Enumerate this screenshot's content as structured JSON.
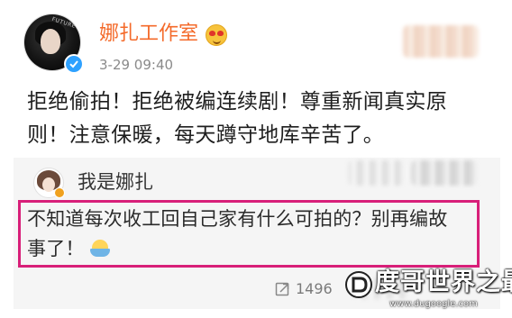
{
  "post": {
    "author_name": "娜扎工作室",
    "time": "3-29 09:40",
    "text_lines": [
      "拒绝偷拍！拒绝被编连续剧！尊重新闻真实原",
      "则！注意保暖，每天蹲守地库辛苦了。"
    ],
    "avatar_text": "FUTURE",
    "verified": true,
    "name_color": "#f46a2a"
  },
  "comment": {
    "author_name": "我是娜扎",
    "text_lines": [
      "不知道每次收工回自己家有什么可拍的？别再编故",
      "事了！"
    ],
    "highlight_color": "#d81f79"
  },
  "actions": {
    "repost_count": "1496"
  },
  "watermark": {
    "title": "度哥世界之最",
    "url": "www.dugoogle.com"
  },
  "icons": {
    "verify": "verified-check-icon",
    "author_emoji": "heart-eyes-emoji-icon",
    "comment_emoji": "happy-emoji-icon",
    "repost": "repost-icon",
    "watermark_logo": "dugoogle-logo-icon"
  }
}
